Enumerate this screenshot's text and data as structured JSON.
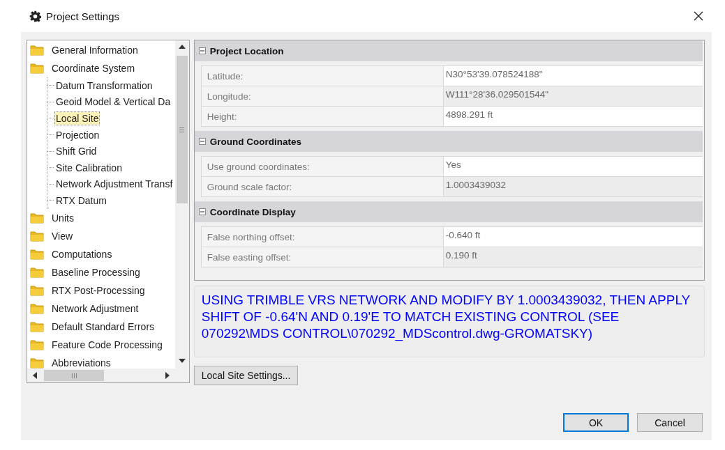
{
  "window": {
    "title": "Project Settings"
  },
  "tree": {
    "items": [
      {
        "label": "General Information",
        "selected": false
      },
      {
        "label": "Coordinate System",
        "selected": false,
        "expanded": true,
        "children": [
          {
            "label": "Datum Transformation",
            "selected": false
          },
          {
            "label": "Geoid Model & Vertical Da",
            "selected": false
          },
          {
            "label": "Local Site",
            "selected": true
          },
          {
            "label": "Projection",
            "selected": false
          },
          {
            "label": "Shift Grid",
            "selected": false
          },
          {
            "label": "Site Calibration",
            "selected": false
          },
          {
            "label": "Network Adjustment Transf",
            "selected": false
          },
          {
            "label": "RTX Datum",
            "selected": false
          }
        ]
      },
      {
        "label": "Units",
        "selected": false
      },
      {
        "label": "View",
        "selected": false
      },
      {
        "label": "Computations",
        "selected": false
      },
      {
        "label": "Baseline Processing",
        "selected": false
      },
      {
        "label": "RTX Post-Processing",
        "selected": false
      },
      {
        "label": "Network Adjustment",
        "selected": false
      },
      {
        "label": "Default Standard Errors",
        "selected": false
      },
      {
        "label": "Feature Code Processing",
        "selected": false
      },
      {
        "label": "Abbreviations",
        "selected": false
      }
    ]
  },
  "properties": {
    "categories": [
      {
        "title": "Project Location",
        "expanded": true,
        "rows": [
          {
            "label": "Latitude:",
            "value": "N30°53'39.078524188\"",
            "editable": true
          },
          {
            "label": "Longitude:",
            "value": "W111°28'36.029501544\"",
            "editable": false
          },
          {
            "label": "Height:",
            "value": "4898.291 ft",
            "editable": true
          }
        ]
      },
      {
        "title": "Ground Coordinates",
        "expanded": true,
        "rows": [
          {
            "label": "Use ground coordinates:",
            "value": "Yes",
            "editable": true
          },
          {
            "label": "Ground scale factor:",
            "value": "1.0003439032",
            "editable": false
          }
        ]
      },
      {
        "title": "Coordinate Display",
        "expanded": true,
        "rows": [
          {
            "label": "False northing offset:",
            "value": "-0.640 ft",
            "editable": true
          },
          {
            "label": "False easting offset:",
            "value": "0.190 ft",
            "editable": false
          }
        ]
      }
    ]
  },
  "note": "USING TRIMBLE VRS NETWORK AND MODIFY BY 1.0003439032, THEN APPLY SHIFT OF -0.64'N AND 0.19'E TO MATCH EXISTING CONTROL (SEE 070292\\MDS CONTROL\\070292_MDScontrol.dwg-GROMATSKY)",
  "settings_button": "Local Site Settings...",
  "buttons": [
    {
      "label": "OK",
      "default": true
    },
    {
      "label": "Cancel",
      "default": false
    }
  ]
}
